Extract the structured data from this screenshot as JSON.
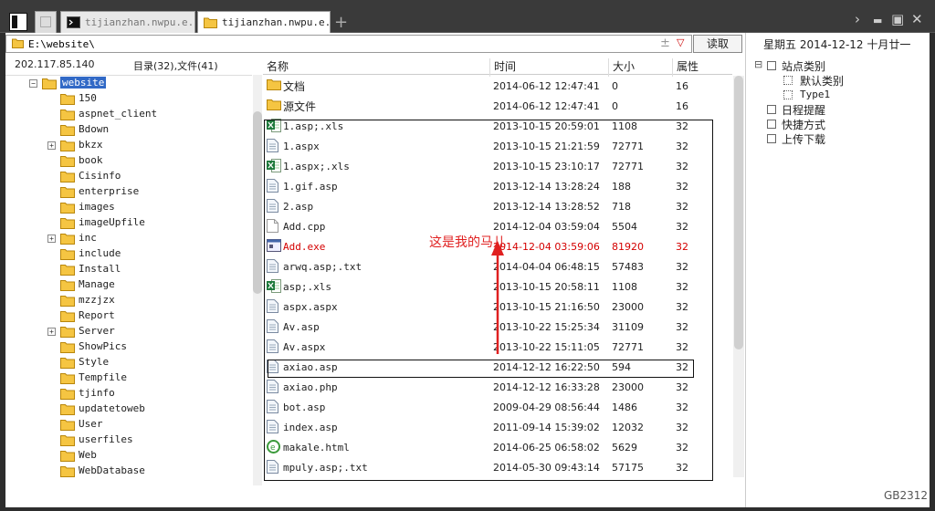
{
  "tabs": [
    {
      "label": "tijianzhan.nwpu.e..."
    },
    {
      "label": "tijianzhan.nwpu.e..."
    }
  ],
  "window": {
    "chevron": "›",
    "minimize": "▬",
    "maximize": "▣",
    "close": "✕",
    "new_tab": "+"
  },
  "address": {
    "value": "E:\\website\\",
    "add": "±",
    "dropdown": "▽"
  },
  "read_button": "读取",
  "calendar": "星期五 2014-12-12 十月廿一",
  "left_header": {
    "ip": "202.117.85.140",
    "counts": "目录(32),文件(41)"
  },
  "tree": {
    "root": "website",
    "folders": [
      {
        "name": "150",
        "expandable": false
      },
      {
        "name": "aspnet_client",
        "expandable": false
      },
      {
        "name": "Bdown",
        "expandable": false
      },
      {
        "name": "bkzx",
        "expandable": true
      },
      {
        "name": "book",
        "expandable": false
      },
      {
        "name": "Cisinfo",
        "expandable": false
      },
      {
        "name": "enterprise",
        "expandable": false
      },
      {
        "name": "images",
        "expandable": false
      },
      {
        "name": "imageUpfile",
        "expandable": false
      },
      {
        "name": "inc",
        "expandable": true
      },
      {
        "name": "include",
        "expandable": false
      },
      {
        "name": "Install",
        "expandable": false
      },
      {
        "name": "Manage",
        "expandable": false
      },
      {
        "name": "mzzjzx",
        "expandable": false
      },
      {
        "name": "Report",
        "expandable": false
      },
      {
        "name": "Server",
        "expandable": true
      },
      {
        "name": "ShowPics",
        "expandable": false
      },
      {
        "name": "Style",
        "expandable": false
      },
      {
        "name": "Tempfile",
        "expandable": false
      },
      {
        "name": "tjinfo",
        "expandable": false
      },
      {
        "name": "updatetoweb",
        "expandable": false
      },
      {
        "name": "User",
        "expandable": false
      },
      {
        "name": "userfiles",
        "expandable": false
      },
      {
        "name": "Web",
        "expandable": false
      },
      {
        "name": "WebDatabase",
        "expandable": false
      }
    ]
  },
  "columns": {
    "name": "名称",
    "time": "时间",
    "size": "大小",
    "attr": "属性"
  },
  "files": [
    {
      "name": "文档",
      "time": "2014-06-12 12:47:41",
      "size": "0",
      "attr": "16",
      "icon": "folder",
      "cn": true
    },
    {
      "name": "源文件",
      "time": "2014-06-12 12:47:41",
      "size": "0",
      "attr": "16",
      "icon": "folder",
      "cn": true
    },
    {
      "name": "1.asp;.xls",
      "time": "2013-10-15 20:59:01",
      "size": "1108",
      "attr": "32",
      "icon": "excel"
    },
    {
      "name": "1.aspx",
      "time": "2013-10-15 21:21:59",
      "size": "72771",
      "attr": "32",
      "icon": "doc"
    },
    {
      "name": "1.aspx;.xls",
      "time": "2013-10-15 23:10:17",
      "size": "72771",
      "attr": "32",
      "icon": "excel"
    },
    {
      "name": "1.gif.asp",
      "time": "2013-12-14 13:28:24",
      "size": "188",
      "attr": "32",
      "icon": "doc"
    },
    {
      "name": "2.asp",
      "time": "2013-12-14 13:28:52",
      "size": "718",
      "attr": "32",
      "icon": "doc"
    },
    {
      "name": "Add.cpp",
      "time": "2014-12-04 03:59:04",
      "size": "5504",
      "attr": "32",
      "icon": "blank"
    },
    {
      "name": "Add.exe",
      "time": "2014-12-04 03:59:06",
      "size": "81920",
      "attr": "32",
      "icon": "exe",
      "highlight": true
    },
    {
      "name": "arwq.asp;.txt",
      "time": "2014-04-04 06:48:15",
      "size": "57483",
      "attr": "32",
      "icon": "doc"
    },
    {
      "name": "asp;.xls",
      "time": "2013-10-15 20:58:11",
      "size": "1108",
      "attr": "32",
      "icon": "excel"
    },
    {
      "name": "aspx.aspx",
      "time": "2013-10-15 21:16:50",
      "size": "23000",
      "attr": "32",
      "icon": "doc"
    },
    {
      "name": "Av.asp",
      "time": "2013-10-22 15:25:34",
      "size": "31109",
      "attr": "32",
      "icon": "doc"
    },
    {
      "name": "Av.aspx",
      "time": "2013-10-22 15:11:05",
      "size": "72771",
      "attr": "32",
      "icon": "doc"
    },
    {
      "name": "axiao.asp",
      "time": "2014-12-12 16:22:50",
      "size": "594",
      "attr": "32",
      "icon": "doc"
    },
    {
      "name": "axiao.php",
      "time": "2014-12-12 16:33:28",
      "size": "23000",
      "attr": "32",
      "icon": "doc"
    },
    {
      "name": "bot.asp",
      "time": "2009-04-29 08:56:44",
      "size": "1486",
      "attr": "32",
      "icon": "doc"
    },
    {
      "name": "index.asp",
      "time": "2011-09-14 15:39:02",
      "size": "12032",
      "attr": "32",
      "icon": "doc"
    },
    {
      "name": "makale.html",
      "time": "2014-06-25 06:58:02",
      "size": "5629",
      "attr": "32",
      "icon": "ie"
    },
    {
      "name": "mpuly.asp;.txt",
      "time": "2014-05-30 09:43:14",
      "size": "57175",
      "attr": "32",
      "icon": "doc"
    }
  ],
  "annotation": "这是我的马儿",
  "right_tree": [
    {
      "label": "站点类别",
      "level": 0,
      "expander": "⊟"
    },
    {
      "label": "默认类别",
      "level": 1
    },
    {
      "label": "Type1",
      "level": 1,
      "mono": true
    },
    {
      "label": "日程提醒",
      "level": 0
    },
    {
      "label": "快捷方式",
      "level": 0
    },
    {
      "label": "上传下载",
      "level": 0
    }
  ],
  "encoding": "GB2312",
  "colors": {
    "accent": "#3169c6",
    "highlight": "#d40000",
    "annotation": "#e02020"
  }
}
